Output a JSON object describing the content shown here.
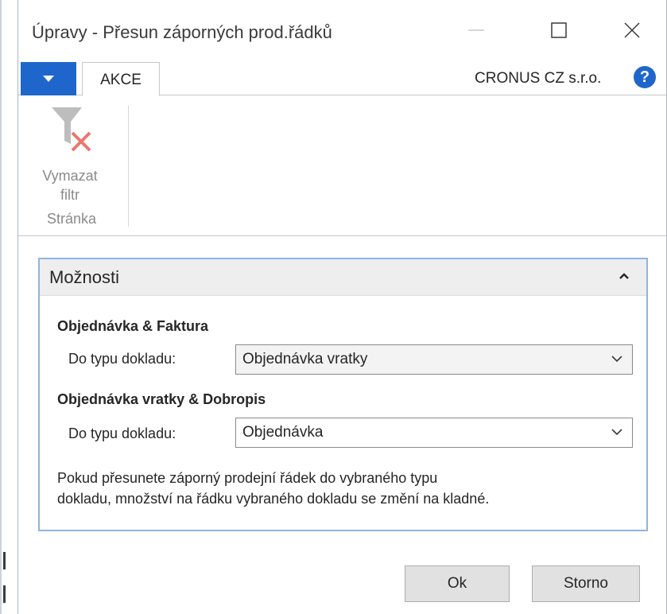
{
  "window": {
    "title": "Úpravy - Přesun záporných prod.řádků",
    "minimize_icon": "minimize-icon",
    "maximize_icon": "maximize-icon",
    "close_icon": "close-icon"
  },
  "ribbon": {
    "menu_icon": "dropdown-arrow-icon",
    "tab_label": "AKCE",
    "company": "CRONUS CZ s.r.o.",
    "help_label": "?",
    "clear_filter_label_line1": "Vymazat",
    "clear_filter_label_line2": "filtr",
    "group_label": "Stránka",
    "accent_color": "#1f66cc"
  },
  "options": {
    "title": "Možnosti",
    "section1_title": "Objednávka & Faktura",
    "section1_label": "Do typu dokladu:",
    "section1_value": "Objednávka vratky",
    "section2_title": "Objednávka vratky & Dobropis",
    "section2_label": "Do typu dokladu:",
    "section2_value": "Objednávka",
    "note_line1": "Pokud přesunete záporný prodejní řádek do vybraného typu",
    "note_line2": "dokladu, množství na řádku vybraného dokladu se změní na kladné."
  },
  "buttons": {
    "ok": "Ok",
    "cancel": "Storno"
  }
}
